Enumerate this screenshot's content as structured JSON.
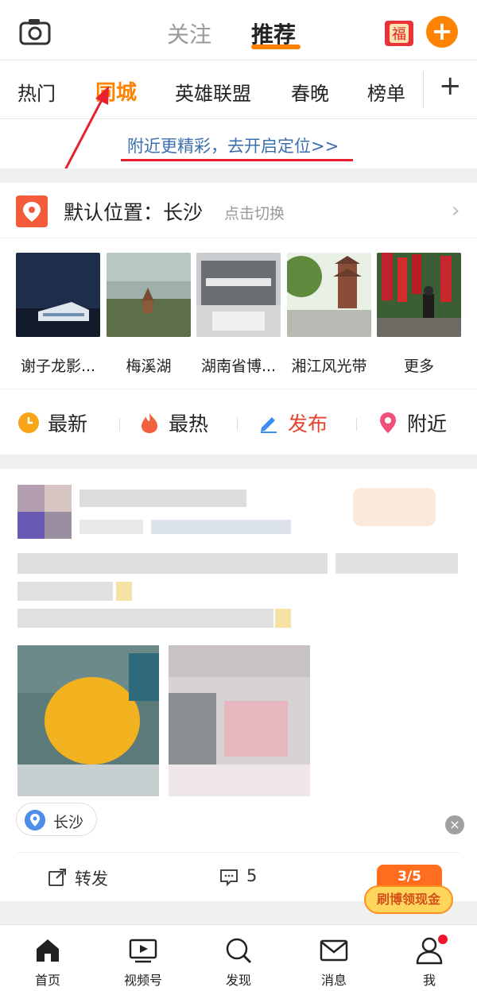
{
  "header": {
    "tabs": [
      {
        "label": "关注",
        "active": false
      },
      {
        "label": "推荐",
        "active": true
      }
    ],
    "camera_icon": "camera-icon",
    "fu_icon_label": "福",
    "plus_label": "+"
  },
  "channels": {
    "items": [
      "热门",
      "同城",
      "英雄联盟",
      "春晚",
      "榜单"
    ],
    "active": "同城",
    "add_label": "+"
  },
  "location_hint": "附近更精彩，去开启定位>>",
  "position": {
    "label": "默认位置：长沙",
    "switch_label": "点击切换",
    "chevron": "›"
  },
  "places": [
    {
      "name": "谢子龙影..."
    },
    {
      "name": "梅溪湖"
    },
    {
      "name": "湖南省博..."
    },
    {
      "name": "湘江风光带"
    },
    {
      "name": "更多"
    }
  ],
  "feed_tabs": [
    {
      "label": "最新",
      "icon": "clock-icon"
    },
    {
      "label": "最热",
      "icon": "fire-icon"
    },
    {
      "label": "发布",
      "icon": "pencil-icon"
    },
    {
      "label": "附近",
      "icon": "location-pin-icon"
    }
  ],
  "post": {
    "location": "长沙",
    "actions": {
      "repost_label": "转发",
      "comment_count": "5"
    }
  },
  "promo": {
    "progress": "3/5",
    "label": "刷博领现金"
  },
  "bottom_nav": [
    {
      "label": "首页",
      "icon": "home-icon"
    },
    {
      "label": "视频号",
      "icon": "video-icon"
    },
    {
      "label": "发现",
      "icon": "search-icon"
    },
    {
      "label": "消息",
      "icon": "mail-icon"
    },
    {
      "label": "我",
      "icon": "profile-icon"
    }
  ],
  "colors": {
    "accent": "#ff8200",
    "link": "#3b6fae",
    "annotation_red": "#e8212c"
  }
}
